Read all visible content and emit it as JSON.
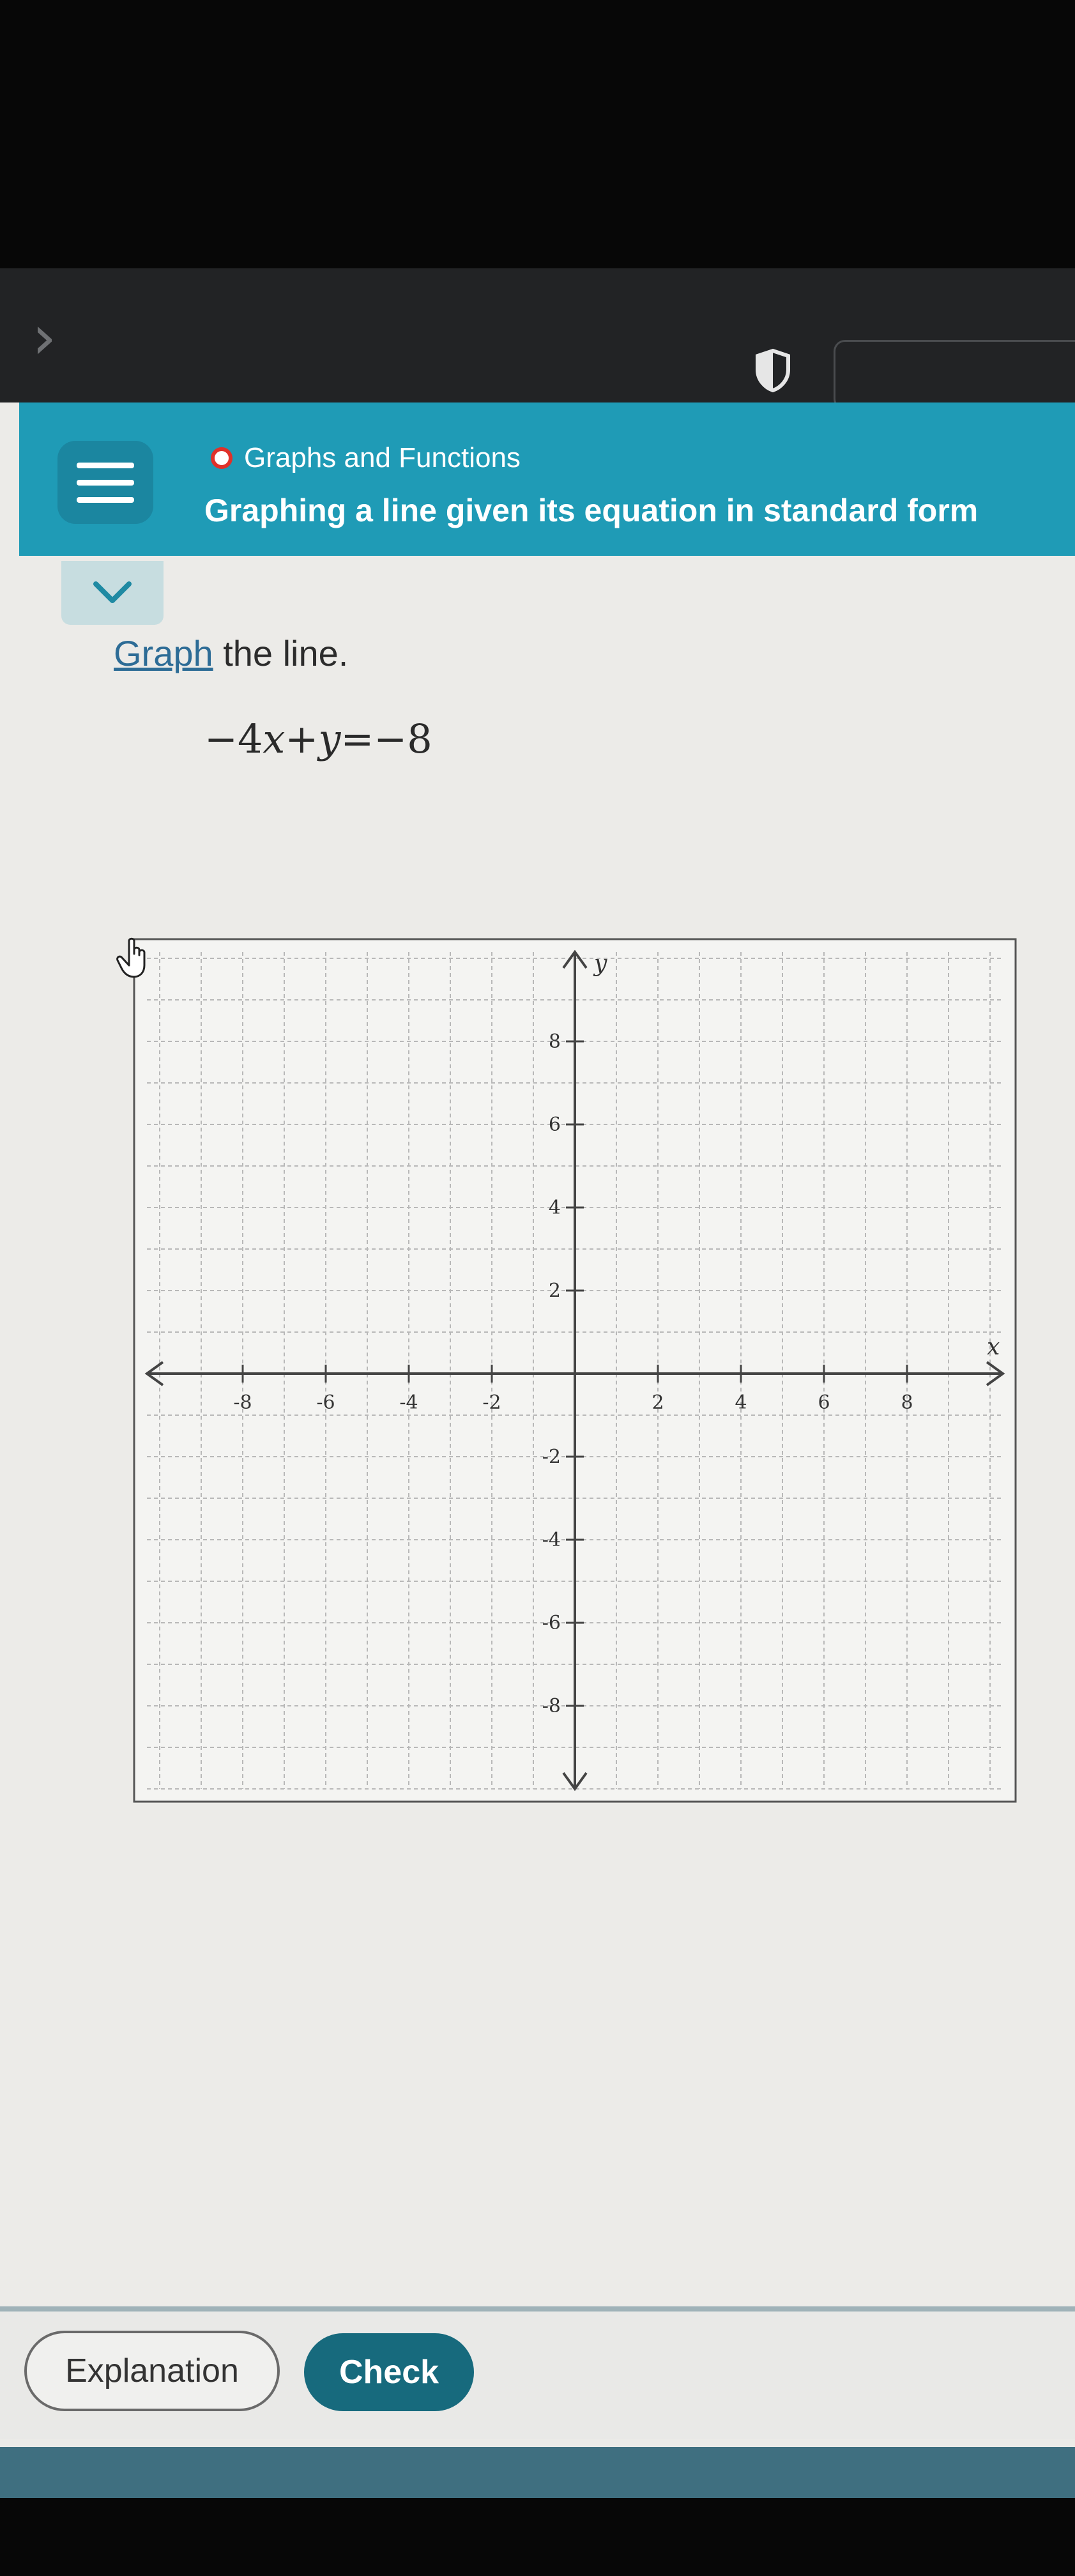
{
  "header": {
    "topic": "Graphs and Functions",
    "lesson_title": "Graphing a line given its equation in standard form"
  },
  "problem": {
    "instruction_link": "Graph",
    "instruction_rest": " the line.",
    "equation": {
      "part1": "−4",
      "var1": "x",
      "part2": "+",
      "var2": "y",
      "part3": "=−8"
    }
  },
  "graph": {
    "x_label": "x",
    "y_label": "y",
    "x_ticks": [
      "-8",
      "-6",
      "-4",
      "-2",
      "2",
      "4",
      "6",
      "8"
    ],
    "y_ticks": [
      "8",
      "6",
      "4",
      "2",
      "-2",
      "-4",
      "-6",
      "-8"
    ],
    "xlim": [
      -10,
      10
    ],
    "ylim": [
      -10,
      10
    ],
    "grid": true
  },
  "footer": {
    "explanation_label": "Explanation",
    "check_label": "Check"
  },
  "colors": {
    "header": "#1f9bb6",
    "check_button": "#176a7d",
    "status_dot": "#e0312a"
  },
  "icons": [
    "back-chevron-icon",
    "shield-icon",
    "menu-icon",
    "chevron-down-icon",
    "hand-pointer-icon"
  ]
}
